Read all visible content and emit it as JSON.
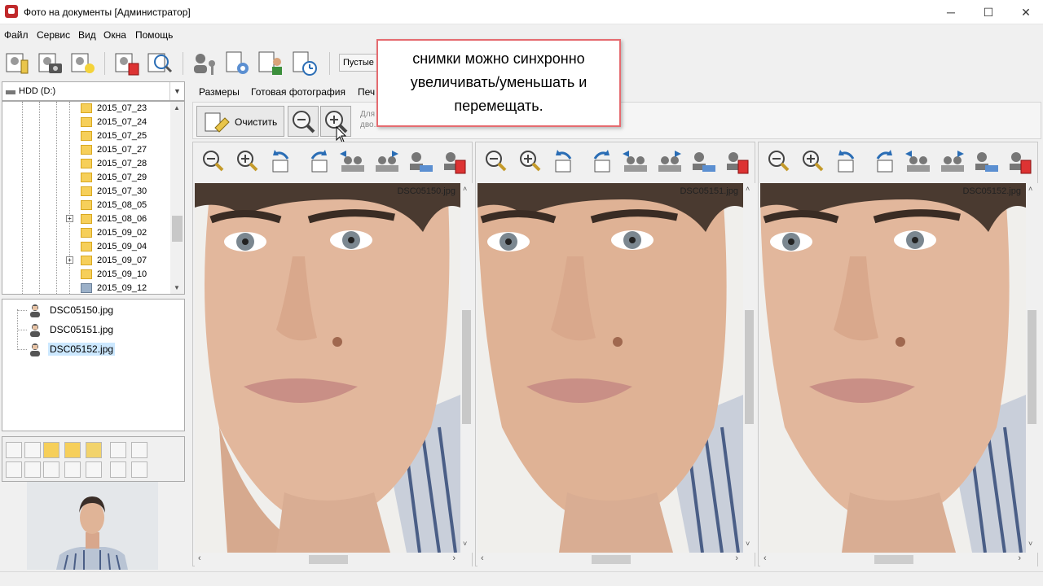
{
  "window": {
    "title": "Фото на документы  [Администратор]",
    "minimize": "─",
    "maximize": "☐",
    "close": "✕"
  },
  "menu": [
    "Файл",
    "Сервис",
    "Вид",
    "Окна",
    "Помощь"
  ],
  "toolbar": {
    "empty_button": "Пустые"
  },
  "drive": {
    "label": "HDD (D:)"
  },
  "folders": [
    "2015_07_23",
    "2015_07_24",
    "2015_07_25",
    "2015_07_27",
    "2015_07_28",
    "2015_07_29",
    "2015_07_30",
    "2015_08_05",
    "2015_08_06",
    "2015_09_02",
    "2015_09_04",
    "2015_09_07",
    "2015_09_10",
    "2015_09_12"
  ],
  "files": [
    {
      "name": "DSC05150.jpg",
      "selected": false
    },
    {
      "name": "DSC05151.jpg",
      "selected": false
    },
    {
      "name": "DSC05152.jpg",
      "selected": true
    }
  ],
  "tabs": [
    "Размеры",
    "Готовая фотография",
    "Печ"
  ],
  "actions": {
    "clear_label": "Очистить",
    "hint_line1": "Для ...                                                                                               ите их",
    "hint_line2": "дво...                                                                                  ...ов"
  },
  "callout": {
    "line1": "снимки можно синхронно",
    "line2": "увеличивать/уменьшать и",
    "line3": "перемещать."
  },
  "panels": [
    {
      "filename": "DSC05150.jpg"
    },
    {
      "filename": "DSC05151.jpg"
    },
    {
      "filename": "DSC05152.jpg"
    }
  ],
  "colors": {
    "accent_border": "#e56b70",
    "selection": "#cce8ff",
    "folder": "#f6cf5a"
  }
}
